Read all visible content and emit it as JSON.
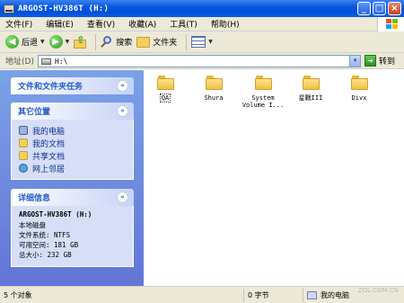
{
  "window": {
    "title": "ARGOST-HV386T (H:)",
    "buttons": {
      "minimize": "_",
      "maximize": "□",
      "close": "×"
    }
  },
  "menu": [
    "文件(F)",
    "编辑(E)",
    "查看(V)",
    "收藏(A)",
    "工具(T)",
    "帮助(H)"
  ],
  "toolbar": {
    "back_label": "后退",
    "search_label": "搜索",
    "folders_label": "文件夹"
  },
  "address": {
    "label": "地址(D)",
    "value": "H:\\",
    "go_label": "转到"
  },
  "sidebar": {
    "file_tasks": {
      "title": "文件和文件夹任务",
      "toggle": "»"
    },
    "other_places": {
      "title": "其它位置",
      "toggle": "«",
      "items": [
        {
          "label": "我的电脑",
          "icon": "my-computer-icon"
        },
        {
          "label": "我的文档",
          "icon": "my-documents-icon"
        },
        {
          "label": "共享文档",
          "icon": "shared-documents-icon"
        },
        {
          "label": "网上邻居",
          "icon": "network-places-icon"
        }
      ]
    },
    "details": {
      "title": "详细信息",
      "toggle": "«",
      "name": "ARGOST-HV386T (H:)",
      "type": "本地磁盘",
      "filesystem": "文件系统: NTFS",
      "free": "可用空间: 181 GB",
      "total": "总大小: 232 GB"
    }
  },
  "files": [
    {
      "name": "QA",
      "icon": "folder-icon",
      "selected": true
    },
    {
      "name": "Shura",
      "icon": "folder-icon"
    },
    {
      "name": "System Volume I...",
      "icon": "folder-icon"
    },
    {
      "name": "星戰III",
      "icon": "folder-icon"
    },
    {
      "name": "Divx",
      "icon": "folder-icon"
    }
  ],
  "status": {
    "objects": "5 个对象",
    "size": "0 字节",
    "location": "我的电脑",
    "watermark": "ZOL.COM.CN"
  }
}
